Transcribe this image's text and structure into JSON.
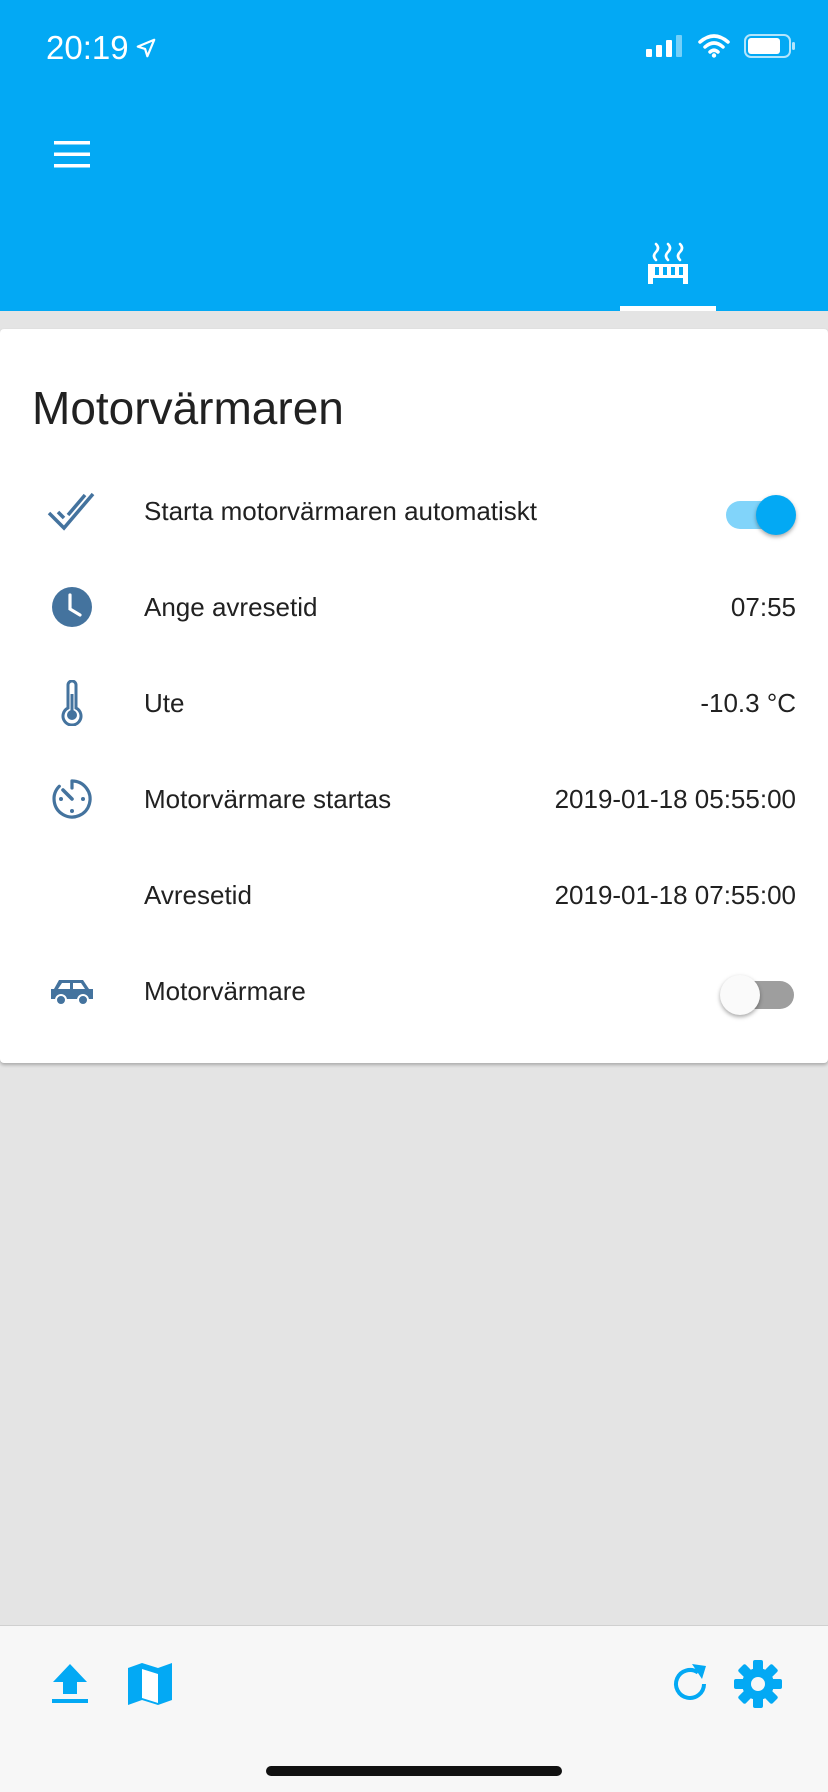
{
  "status_bar": {
    "time": "20:19"
  },
  "header": {
    "active_tab_icon": "radiator-icon"
  },
  "card": {
    "title": "Motorvärmaren",
    "rows": [
      {
        "icon": "check-all-icon",
        "label": "Starta motorvärmaren automatiskt",
        "control": "switch",
        "state": "on"
      },
      {
        "icon": "clock-icon",
        "label": "Ange avresetid",
        "value": "07:55"
      },
      {
        "icon": "thermometer-icon",
        "label": "Ute",
        "value": "-10.3 °C"
      },
      {
        "icon": "timer-icon",
        "label": "Motorvärmare startas",
        "value": "2019-01-18 05:55:00"
      },
      {
        "icon": "",
        "label": "Avresetid",
        "value": "2019-01-18 07:55:00"
      },
      {
        "icon": "car-icon",
        "label": "Motorvärmare",
        "control": "switch",
        "state": "off"
      }
    ]
  },
  "bottom_bar": {
    "left": [
      "upload-icon",
      "map-icon"
    ],
    "right": [
      "refresh-icon",
      "settings-icon"
    ]
  },
  "colors": {
    "accent": "#03a9f4",
    "icon": "#44739e",
    "background": "#e4e4e4"
  }
}
